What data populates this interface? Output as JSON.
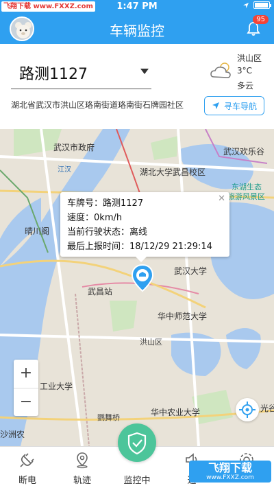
{
  "status_bar": {
    "carrier": "飞翔下载 www.FXXZ.com",
    "time": "1:47 PM"
  },
  "header": {
    "title": "车辆监控",
    "notification_count": "95"
  },
  "vehicle": {
    "plate": "路测1127"
  },
  "weather": {
    "district": "洪山区",
    "temperature": "3°C",
    "condition": "多云"
  },
  "address": "湖北省武汉市洪山区珞南街道珞南街石牌园社区",
  "nav_button_label": "寻车导航",
  "map": {
    "labels": {
      "wuhan_gov": "武汉市政府",
      "jianghan": "江汉",
      "hubu_campus": "湖北大学武昌校区",
      "happy_valley": "武汉欢乐谷",
      "east_lake": "东湖生态",
      "scenic": "旅游风景区",
      "qingchuan": "晴川阁",
      "wuchang_station": "武昌站",
      "whu": "武汉大学",
      "ccnu": "华中师范大学",
      "hongshan": "洪山区",
      "hzau": "华中农业大学",
      "industrial": "工业大学",
      "guanggu": "光谷",
      "shazhou": "沙洲农",
      "jiuyuan": "鹦舞桥"
    },
    "popup": {
      "plate_label": "车牌号：",
      "plate_value": "路测1127",
      "speed_label": "速度：",
      "speed_value": "0km/h",
      "state_label": "当前行驶状态：",
      "state_value": "离线",
      "report_label": "最后上报时间：",
      "report_value": "18/12/29 21:29:14"
    },
    "zoom_in": "+",
    "zoom_out": "−"
  },
  "tabs": [
    {
      "label": "断电",
      "icon": "plug-icon"
    },
    {
      "label": "轨迹",
      "icon": "location-pin-icon"
    },
    {
      "label": "监控中",
      "icon": "shield-check-icon"
    },
    {
      "label": "通",
      "icon": "speaker-icon"
    },
    {
      "label": "",
      "icon": "settings-icon"
    }
  ],
  "watermark": {
    "main": "飞翔下载",
    "sub": "www.FXXZ.com"
  },
  "colors": {
    "primary": "#2fa0f0",
    "monitor_green": "#4cc59a",
    "badge_red": "#f44336"
  }
}
